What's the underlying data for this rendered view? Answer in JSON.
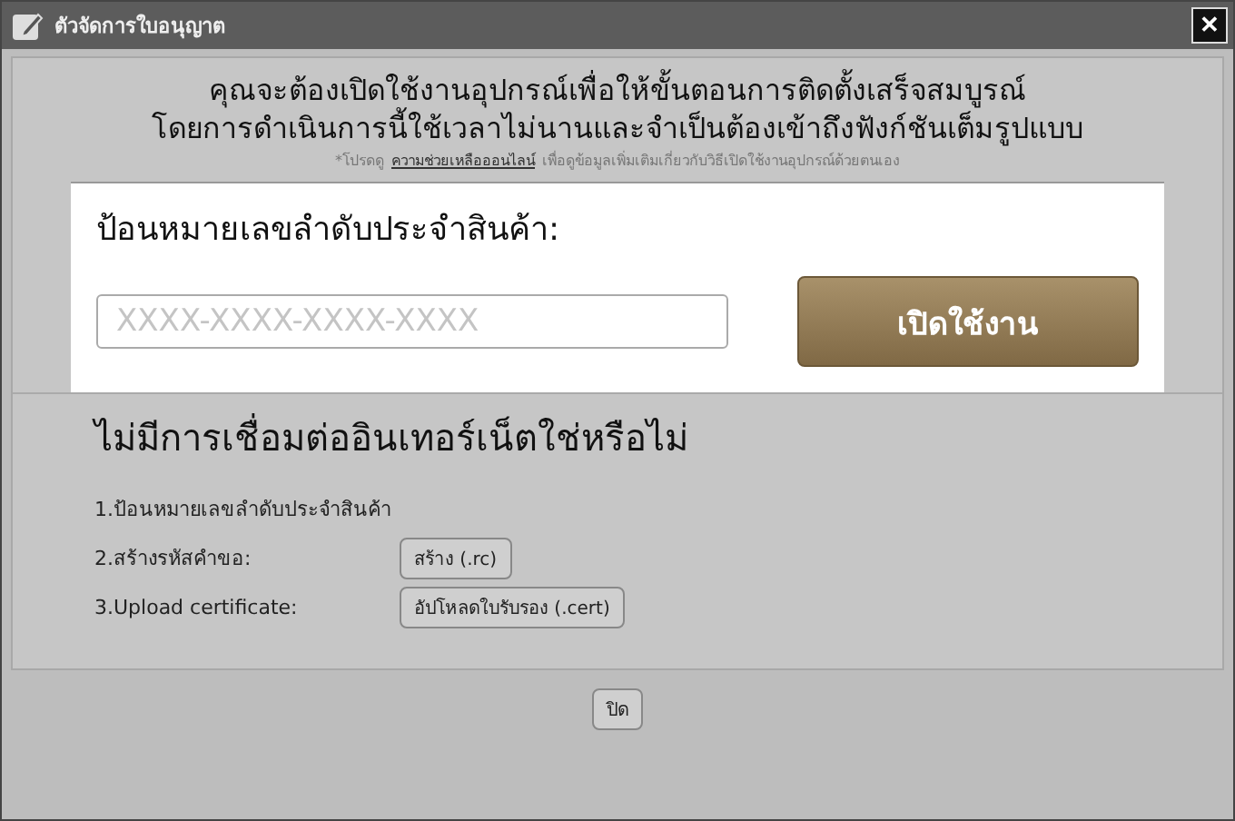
{
  "window": {
    "title": "ตัวจัดการใบอนุญาต",
    "close": "✕"
  },
  "intro": {
    "line_1": "คุณจะต้องเปิดใช้งานอุปกรณ์เพื่อให้ขั้นตอนการติดตั้งเสร็จสมบูรณ์",
    "line_2": "โดยการดำเนินการนี้ใช้เวลาไม่นานและจำเป็นต้องเข้าถึงฟังก์ชันเต็มรูปแบบ",
    "note_before": "*โปรดดู",
    "note_link": "ความช่วยเหลือออนไลน์",
    "note_after": "เพื่อดูข้อมูลเพิ่มเติมเกี่ยวกับวิธีเปิดใช้งานอุปกรณ์ด้วยตนเอง"
  },
  "serial": {
    "heading": "ป้อนหมายเลขลำดับประจำสินค้า:",
    "placeholder": "XXXX-XXXX-XXXX-XXXX",
    "button": "เปิดใช้งาน"
  },
  "offline": {
    "heading": "ไม่มีการเชื่อมต่ออินเทอร์เน็ตใช่หรือไม่",
    "steps": [
      {
        "label": "1.ป้อนหมายเลขลำดับประจำสินค้า"
      },
      {
        "label": "2.สร้างรหัสคำขอ:",
        "button": "สร้าง (.rc)"
      },
      {
        "label": "3.Upload certificate:",
        "button": "อัปโหลดใบรับรอง (.cert)"
      }
    ]
  },
  "buttons": [
    "ปิด"
  ]
}
